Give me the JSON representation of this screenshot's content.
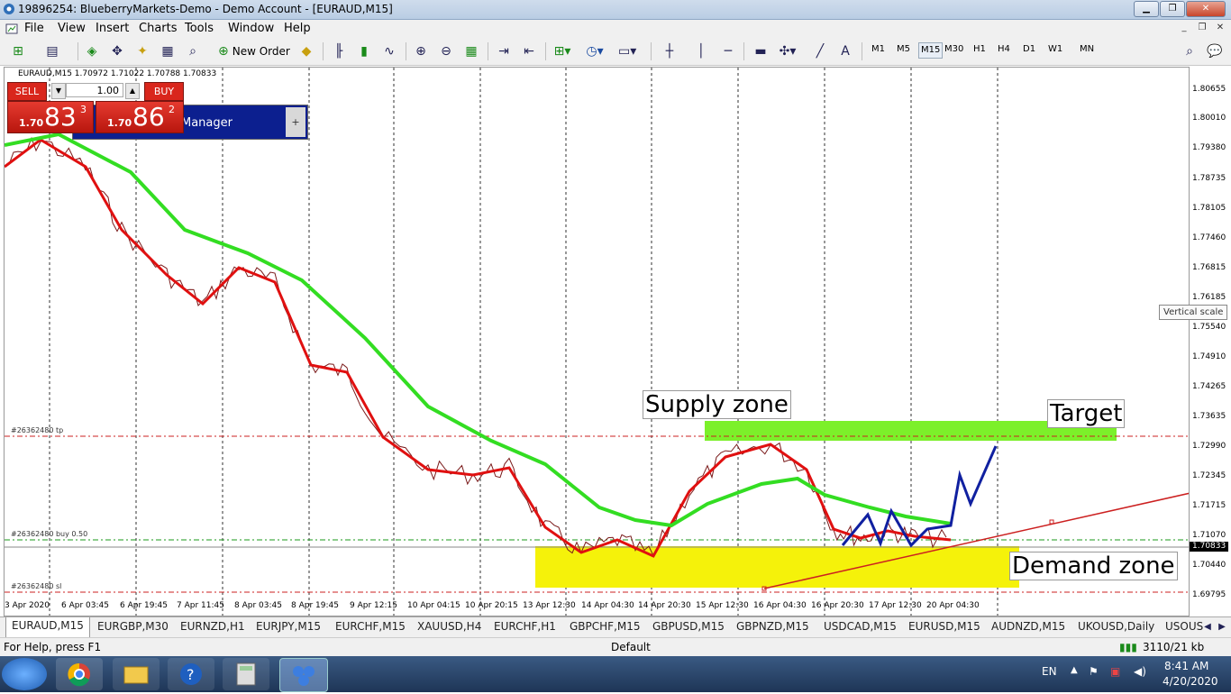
{
  "window": {
    "title": "19896254: BlueberryMarkets-Demo - Demo Account - [EURAUD,M15]"
  },
  "menu": [
    "File",
    "View",
    "Insert",
    "Charts",
    "Tools",
    "Window",
    "Help"
  ],
  "toolbar": {
    "new_order": "New Order",
    "timeframes": [
      "M1",
      "M5",
      "M15",
      "M30",
      "H1",
      "H4",
      "D1",
      "W1",
      "MN"
    ],
    "active_timeframe": "M15"
  },
  "chart": {
    "header": "EURAUD,M15  1.70972 1.71022 1.70788 1.70833",
    "price_labels": [
      "1.80655",
      "1.80010",
      "1.79380",
      "1.78735",
      "1.78105",
      "1.77460",
      "1.76815",
      "1.76185",
      "1.75540",
      "1.74910",
      "1.74265",
      "1.73635",
      "1.72990",
      "1.72345",
      "1.71715",
      "1.71070",
      "1.70440",
      "1.69795"
    ],
    "current_price": "1.70833",
    "vertical_scale_tip": "Vertical scale",
    "time_labels": [
      "3 Apr 2020",
      "6 Apr 03:45",
      "6 Apr 19:45",
      "7 Apr 11:45",
      "8 Apr 03:45",
      "8 Apr 19:45",
      "9 Apr 12:15",
      "10 Apr 04:15",
      "10 Apr 20:15",
      "13 Apr 12:30",
      "14 Apr 04:30",
      "14 Apr 20:30",
      "15 Apr 12:30",
      "16 Apr 04:30",
      "16 Apr 20:30",
      "17 Apr 12:30",
      "20 Apr 04:30"
    ],
    "order_lines": {
      "tp": "#26362480 tp",
      "buy": "#26362480 buy 0.50",
      "sl": "#26362480 sl"
    },
    "annotations": {
      "supply": "Supply zone",
      "target": "Target",
      "demand": "Demand zone"
    }
  },
  "one_click": {
    "sell_label": "SELL",
    "buy_label": "BUY",
    "lot": "1.00",
    "sell_small": "1.70",
    "sell_big": "83",
    "sell_sup": "3",
    "buy_small": "1.70",
    "buy_big": "86",
    "buy_sup": "2"
  },
  "trade_manager": {
    "label": "Manager",
    "plus": "+"
  },
  "tabs": [
    "EURAUD,M15",
    "EURGBP,M30",
    "EURNZD,H1",
    "EURJPY,M15",
    "EURCHF,M15",
    "XAUUSD,H4",
    "EURCHF,H1",
    "GBPCHF,M15",
    "GBPUSD,M15",
    "GBPNZD,M15",
    "USDCAD,M15",
    "EURUSD,M15",
    "AUDNZD,M15",
    "UKOUSD,Daily",
    "USOUS"
  ],
  "status": {
    "help": "For Help, press F1",
    "profile": "Default",
    "traffic": "3110/21 kb"
  },
  "taskbar": {
    "lang": "EN",
    "time": "8:41 AM",
    "date": "4/20/2020"
  },
  "colors": {
    "ma_slow": "#33dd22",
    "ma_fast": "#e01010",
    "price": "#8b1a1a",
    "projection": "#1020a0",
    "supply": "#7cf02a",
    "demand": "#f5f20a"
  }
}
